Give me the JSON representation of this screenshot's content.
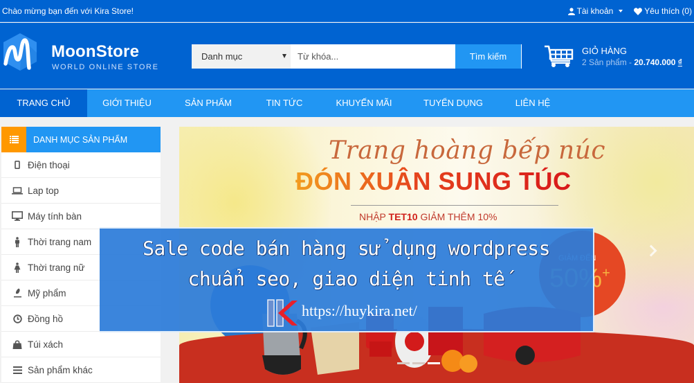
{
  "topbar": {
    "welcome": "Chào mừng bạn đến với Kira Store!",
    "account_label": "Tài khoản",
    "wishlist_label": "Yêu thích (0)"
  },
  "header": {
    "logo_title": "MoonStore",
    "logo_subtitle": "WORLD ONLINE STORE",
    "search": {
      "category_selected": "Danh mục",
      "keyword_value": "",
      "keyword_placeholder": "Từ khóa...",
      "button_label": "Tìm kiếm"
    },
    "cart": {
      "title": "GIỎ HÀNG",
      "count_text": "2 Sản phẩm - ",
      "total": "20.740.000",
      "currency": "₫"
    }
  },
  "nav": {
    "items": [
      {
        "label": "Trang chủ",
        "active": true
      },
      {
        "label": "Giới thiệu",
        "active": false
      },
      {
        "label": "Sản phẩm",
        "active": false
      },
      {
        "label": "Tin tức",
        "active": false
      },
      {
        "label": "Khuyến mãi",
        "active": false
      },
      {
        "label": "Tuyển dụng",
        "active": false
      },
      {
        "label": "Liên hệ",
        "active": false
      }
    ]
  },
  "sidebar": {
    "title": "DANH MỤC SẢN PHẨM",
    "items": [
      {
        "label": "Điện thoại",
        "icon": "mobile-icon"
      },
      {
        "label": "Lap top",
        "icon": "laptop-icon"
      },
      {
        "label": "Máy tính bàn",
        "icon": "desktop-icon"
      },
      {
        "label": "Thời trang nam",
        "icon": "male-icon"
      },
      {
        "label": "Thời trang nữ",
        "icon": "female-icon"
      },
      {
        "label": "Mỹ phẩm",
        "icon": "eyedropper-icon"
      },
      {
        "label": "Đồng hồ",
        "icon": "clock-icon"
      },
      {
        "label": "Túi xách",
        "icon": "shopping-bag-icon"
      },
      {
        "label": "Sản phẩm khác",
        "icon": "bars-icon"
      }
    ]
  },
  "banner": {
    "script_text": "Trang hoàng bếp núc",
    "headline": "ĐÓN XUÂN SUNG TÚC",
    "code_prefix": "NHẬP ",
    "code": "TET10",
    "code_suffix": " GIẢM THÊM 10%",
    "discount_label": "GIẢM ĐẾN",
    "discount_value": "50%",
    "discount_plus": "+",
    "slide_count": 3,
    "active_slide": 3
  },
  "overlay": {
    "line1": "Sale code bán hàng sử dụng wordpress",
    "line2": "chuẩn seo, giao diện tinh tế",
    "url": "https://huykira.net/"
  },
  "colors": {
    "primary_dark": "#0063d1",
    "primary": "#2196f3",
    "accent_orange": "#ff9800",
    "banner_red": "#c82f1f"
  }
}
